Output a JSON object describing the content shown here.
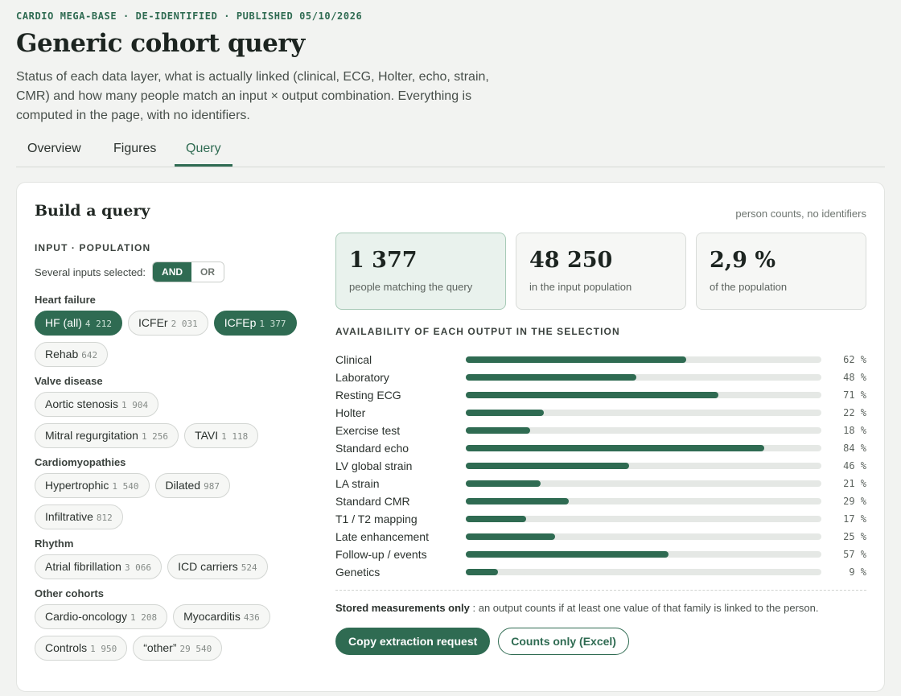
{
  "header": {
    "eyebrow": "CARDIO MEGA-BASE · DE-IDENTIFIED · PUBLISHED 05/10/2026",
    "title": "Generic cohort query",
    "intro": "Status of each data layer, what is actually linked (clinical, ECG, Holter, echo, strain, CMR) and how many people match an input × output combination. Everything is computed in the page, with no identifiers."
  },
  "tabs": [
    {
      "label": "Overview",
      "active": false
    },
    {
      "label": "Figures",
      "active": false
    },
    {
      "label": "Query",
      "active": true
    }
  ],
  "query": {
    "title": "Build a query",
    "note": "person counts, no identifiers",
    "input_label": "INPUT · POPULATION",
    "combine_label": "Several inputs selected:",
    "combine_options": [
      "AND",
      "OR"
    ],
    "combine_selected": "AND",
    "groups": [
      {
        "title": "Heart failure",
        "items": [
          {
            "label": "HF (all)",
            "count": "4 212",
            "selected": true
          },
          {
            "label": "ICFEr",
            "count": "2 031",
            "selected": false
          },
          {
            "label": "ICFEp",
            "count": "1 377",
            "selected": true
          },
          {
            "label": "Rehab",
            "count": "642",
            "selected": false
          }
        ]
      },
      {
        "title": "Valve disease",
        "items": [
          {
            "label": "Aortic stenosis",
            "count": "1 904",
            "selected": false
          },
          {
            "label": "Mitral regurgitation",
            "count": "1 256",
            "selected": false
          },
          {
            "label": "TAVI",
            "count": "1 118",
            "selected": false
          }
        ]
      },
      {
        "title": "Cardiomyopathies",
        "items": [
          {
            "label": "Hypertrophic",
            "count": "1 540",
            "selected": false
          },
          {
            "label": "Dilated",
            "count": "987",
            "selected": false
          },
          {
            "label": "Infiltrative",
            "count": "812",
            "selected": false
          }
        ]
      },
      {
        "title": "Rhythm",
        "items": [
          {
            "label": "Atrial fibrillation",
            "count": "3 066",
            "selected": false
          },
          {
            "label": "ICD carriers",
            "count": "524",
            "selected": false
          }
        ]
      },
      {
        "title": "Other cohorts",
        "items": [
          {
            "label": "Cardio-oncology",
            "count": "1 208",
            "selected": false
          },
          {
            "label": "Myocarditis",
            "count": "436",
            "selected": false
          },
          {
            "label": "Controls",
            "count": "1 950",
            "selected": false
          },
          {
            "label": "“other”",
            "count": "29 540",
            "selected": false
          }
        ]
      }
    ],
    "stats": [
      {
        "value": "1 377",
        "label": "people matching the query",
        "primary": true
      },
      {
        "value": "48 250",
        "label": "in the input population",
        "primary": false
      },
      {
        "value": "2,9 %",
        "label": "of the population",
        "primary": false
      }
    ],
    "availability_title": "AVAILABILITY OF EACH OUTPUT IN THE SELECTION",
    "availability": [
      {
        "label": "Clinical",
        "pct": 62
      },
      {
        "label": "Laboratory",
        "pct": 48
      },
      {
        "label": "Resting ECG",
        "pct": 71
      },
      {
        "label": "Holter",
        "pct": 22
      },
      {
        "label": "Exercise test",
        "pct": 18
      },
      {
        "label": "Standard echo",
        "pct": 84
      },
      {
        "label": "LV global strain",
        "pct": 46
      },
      {
        "label": "LA strain",
        "pct": 21
      },
      {
        "label": "Standard CMR",
        "pct": 29
      },
      {
        "label": "T1 / T2 mapping",
        "pct": 17
      },
      {
        "label": "Late enhancement",
        "pct": 25
      },
      {
        "label": "Follow-up / events",
        "pct": 57
      },
      {
        "label": "Genetics",
        "pct": 9
      }
    ],
    "pct_suffix": " %",
    "footnote_strong": "Stored measurements only",
    "footnote_text": " : an output counts if at least one value of that family is linked to the person.",
    "copy_button": "Copy extraction request",
    "excel_button": "Counts only (Excel)"
  },
  "colors": {
    "accent": "#2f6b52",
    "background": "#f2f3f1"
  }
}
